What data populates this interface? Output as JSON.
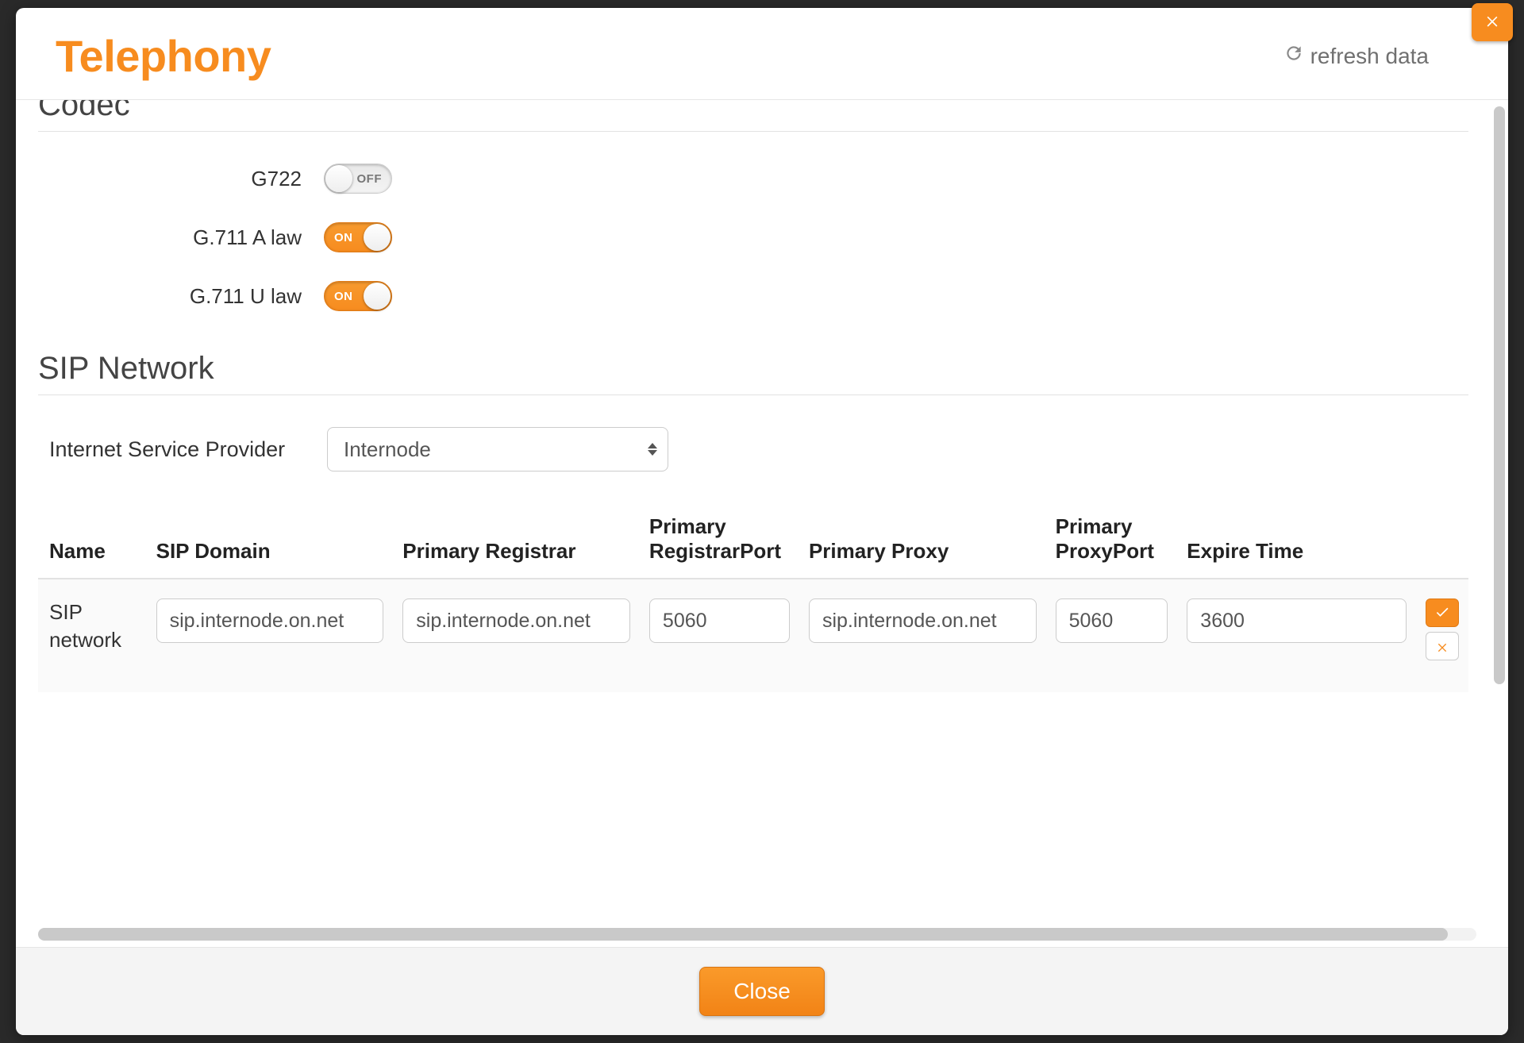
{
  "header": {
    "title": "Telephony",
    "refresh_label": "refresh data"
  },
  "sections": {
    "codec_title": "Codec",
    "sip_title": "SIP Network"
  },
  "codecs": [
    {
      "label": "G722",
      "state": "off",
      "state_text": "OFF"
    },
    {
      "label": "G.711 A law",
      "state": "on",
      "state_text": "ON"
    },
    {
      "label": "G.711 U law",
      "state": "on",
      "state_text": "ON"
    }
  ],
  "sip": {
    "isp_label": "Internet Service Provider",
    "isp_selected": "Internode",
    "columns": {
      "name": "Name",
      "domain": "SIP Domain",
      "registrar": "Primary Registrar",
      "registrar_port": "Primary RegistrarPort",
      "proxy": "Primary Proxy",
      "proxy_port": "Primary ProxyPort",
      "expire": "Expire Time"
    },
    "row": {
      "name": "SIP network",
      "domain": "sip.internode.on.net",
      "registrar": "sip.internode.on.net",
      "registrar_port": "5060",
      "proxy": "sip.internode.on.net",
      "proxy_port": "5060",
      "expire": "3600"
    }
  },
  "footer": {
    "close_label": "Close"
  }
}
